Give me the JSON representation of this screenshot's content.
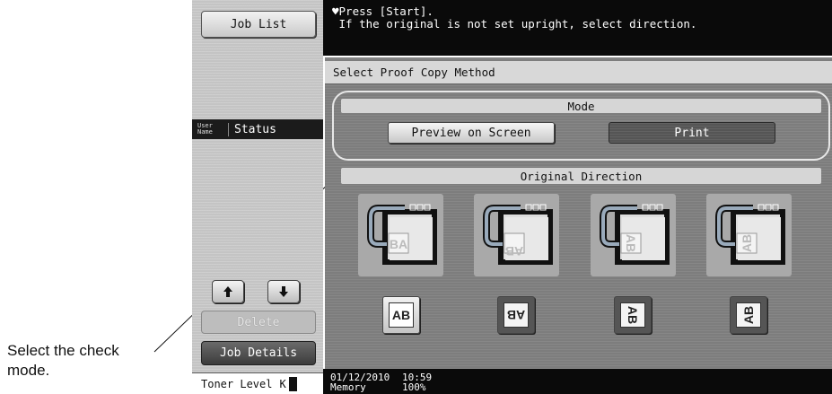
{
  "callout": {
    "line1": "Select the check",
    "line2": "mode."
  },
  "left": {
    "job_list": "Job List",
    "user_name_1": "User",
    "user_name_2": "Name",
    "status": "Status",
    "up_arrow": "🡅",
    "down_arrow": "🡇",
    "delete": "Delete",
    "job_details": "Job Details",
    "toner_label": "Toner Level",
    "toner_color": "K"
  },
  "message": {
    "line1": "Press [Start].",
    "line2": "If the original is not set upright, select direction."
  },
  "dialog": {
    "title": "Select Proof Copy Method",
    "mode_header": "Mode",
    "preview_button": "Preview on Screen",
    "print_button": "Print",
    "direction_header": "Original Direction",
    "direction_options": [
      {
        "label": "AB",
        "rotation": 0,
        "selected": true
      },
      {
        "label": "AB",
        "rotation": 180,
        "selected": false
      },
      {
        "label": "AB",
        "rotation": 90,
        "selected": false
      },
      {
        "label": "AB",
        "rotation": -90,
        "selected": false
      }
    ],
    "tile_glyphs": [
      "BA",
      "AB",
      "AB",
      "AB"
    ]
  },
  "status_bar": {
    "date": "01/12/2010",
    "time": "10:59",
    "memory_label": "Memory",
    "memory_value": "100%"
  },
  "colors": {
    "panel_gray": "#c4c4c4",
    "main_gray": "#7d7d7d",
    "black": "#0a0a0a"
  }
}
